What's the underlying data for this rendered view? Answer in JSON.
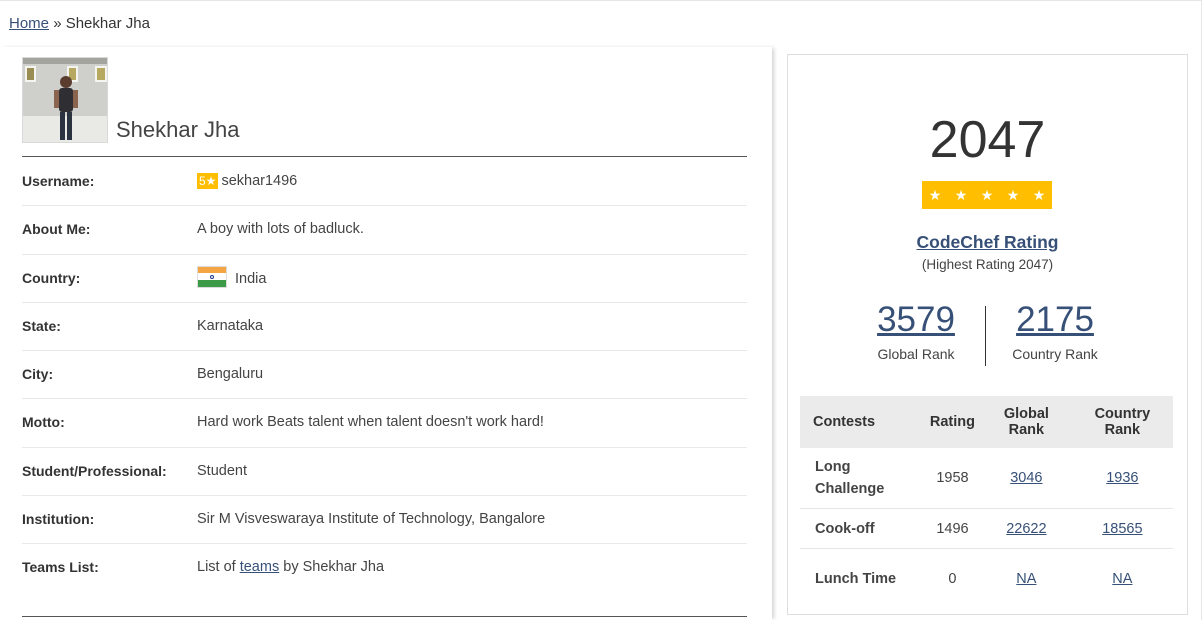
{
  "breadcrumb": {
    "home": "Home",
    "separator": "»",
    "current": "Shekhar Jha"
  },
  "profile": {
    "name": "Shekhar Jha",
    "rows": [
      {
        "label": "Username:",
        "badge": "5★",
        "value": "sekhar1496"
      },
      {
        "label": "About Me:",
        "value": "A boy with lots of badluck."
      },
      {
        "label": "Country:",
        "flag_icon": "india-flag-icon",
        "value": "India"
      },
      {
        "label": "State:",
        "value": "Karnataka"
      },
      {
        "label": "City:",
        "value": "Bengaluru"
      },
      {
        "label": "Motto:",
        "value": "Hard work Beats talent when talent doesn't work hard!"
      },
      {
        "label": "Student/Professional:",
        "value": "Student"
      },
      {
        "label": "Institution:",
        "value": "Sir M Visveswaraya Institute of Technology, Bangalore"
      },
      {
        "label": "Teams List:",
        "prefix": "List of",
        "link": "teams",
        "suffix": "by Shekhar Jha"
      }
    ]
  },
  "rating": {
    "value": "2047",
    "stars": 5,
    "title": "CodeChef Rating",
    "highest": "(Highest Rating 2047)",
    "global_rank": "3579",
    "global_rank_label": "Global Rank",
    "country_rank": "2175",
    "country_rank_label": "Country Rank"
  },
  "contests": {
    "headers": [
      "Contests",
      "Rating",
      "Global Rank",
      "Country Rank"
    ],
    "rows": [
      {
        "name": "Long Challenge",
        "rating": "1958",
        "global": "3046",
        "country": "1936"
      },
      {
        "name": "Cook-off",
        "rating": "1496",
        "global": "22622",
        "country": "18565"
      },
      {
        "name": "Lunch Time",
        "rating": "0",
        "global": "NA",
        "country": "NA"
      }
    ]
  },
  "colors": {
    "link": "#375077",
    "star": "#ffbf00",
    "table_header_bg": "#ebebeb"
  }
}
